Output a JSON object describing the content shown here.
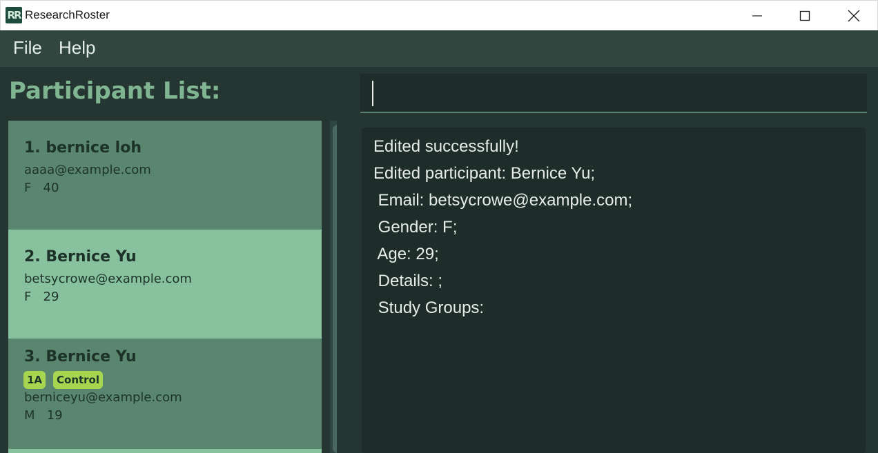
{
  "window": {
    "title": "ResearchRoster",
    "logo_text": "RR"
  },
  "menu": {
    "file": "File",
    "help": "Help"
  },
  "participant_list": {
    "title": "Participant List:",
    "items": [
      {
        "name": "1. bernice loh",
        "tags": [],
        "email": "aaaa@example.com",
        "meta": "F   40"
      },
      {
        "name": "2. Bernice Yu",
        "tags": [],
        "email": "betsycrowe@example.com",
        "meta": "F   29"
      },
      {
        "name": "3. Bernice Yu",
        "tags": [
          "1A",
          "Control"
        ],
        "email": "berniceyu@example.com",
        "meta": "M   19"
      }
    ]
  },
  "command_box": {
    "value": "",
    "placeholder": ""
  },
  "result_display": {
    "lines": [
      "Edited successfully!",
      "Edited participant: Bernice Yu;",
      " Email: betsycrowe@example.com;",
      " Gender: F;",
      " Age: 29;",
      " Details: ;",
      " Study Groups:"
    ]
  },
  "colors": {
    "menubar": "#31463f",
    "card_dark": "#5a8670",
    "card_selected": "#87c19e",
    "tag": "#a6d64f",
    "title_accent": "#7fb591"
  }
}
